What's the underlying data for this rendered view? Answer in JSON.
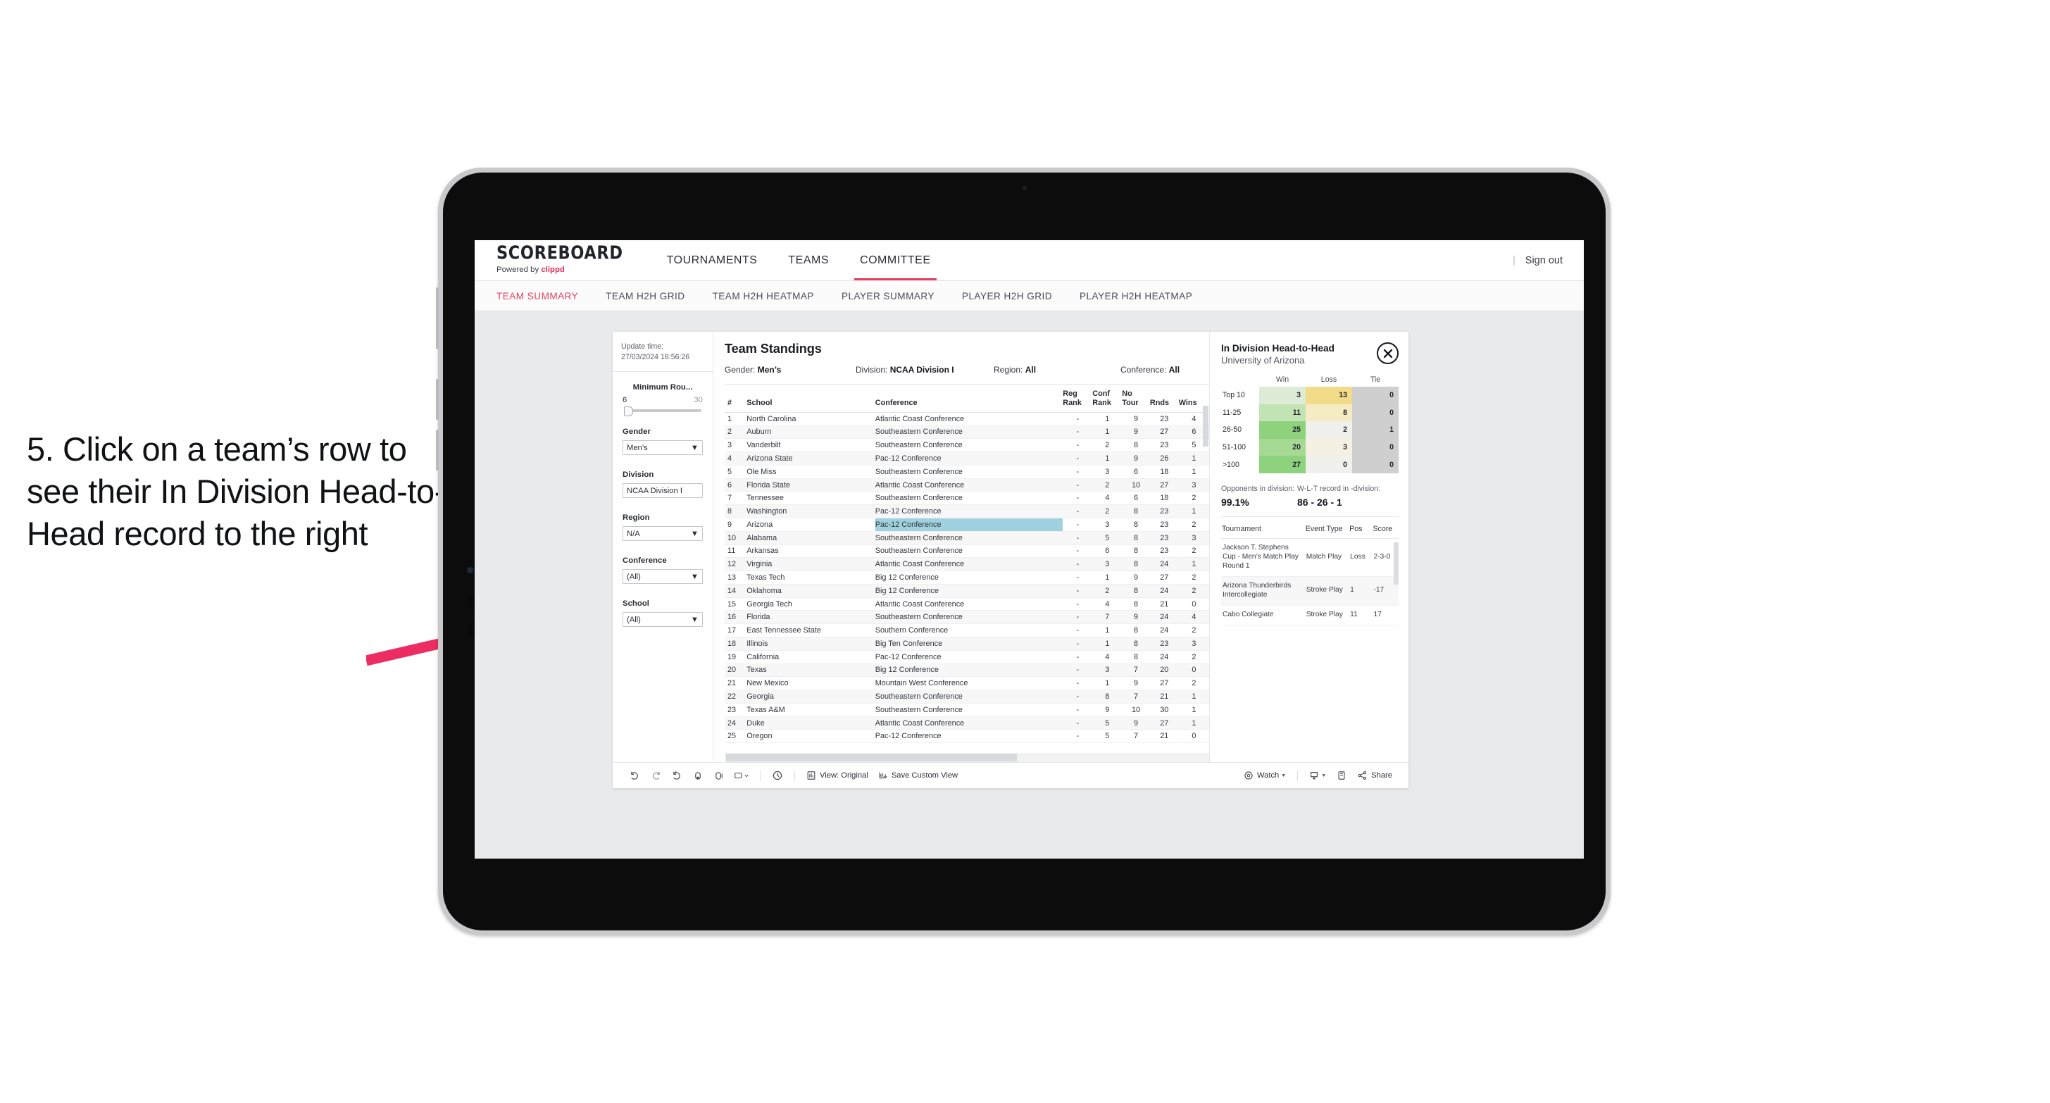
{
  "callout": {
    "text": "5. Click on a team’s row to see their In Division Head-to-Head record to the right"
  },
  "colors": {
    "accent_pink": "#e8415f",
    "arrow_pink": "#ec2d62",
    "highlight_cyan": "#9fd2de",
    "bezel_silver": "#c9c9cb"
  },
  "topnav": {
    "logo_word": "SCOREBOARD",
    "logo_powered": "Powered by ",
    "logo_brand": "clippd",
    "items": [
      {
        "label": "TOURNAMENTS",
        "active": false
      },
      {
        "label": "TEAMS",
        "active": false
      },
      {
        "label": "COMMITTEE",
        "active": true
      }
    ],
    "divider": "|",
    "signout": "Sign out"
  },
  "subnav": {
    "items": [
      {
        "label": "TEAM SUMMARY",
        "active": true
      },
      {
        "label": "TEAM H2H GRID",
        "active": false
      },
      {
        "label": "TEAM H2H HEATMAP",
        "active": false
      },
      {
        "label": "PLAYER SUMMARY",
        "active": false
      },
      {
        "label": "PLAYER H2H GRID",
        "active": false
      },
      {
        "label": "PLAYER H2H HEATMAP",
        "active": false
      }
    ]
  },
  "rail": {
    "update_label": "Update time:",
    "update_value": "27/03/2024 16:56:26",
    "slider": {
      "title": "Minimum Rou...",
      "min": "6",
      "max": "30"
    },
    "filters": [
      {
        "title": "Gender",
        "value": "Men’s"
      },
      {
        "title": "Division",
        "value": "NCAA Division I"
      },
      {
        "title": "Region",
        "value": "N/A"
      },
      {
        "title": "Conference",
        "value": "(All)"
      },
      {
        "title": "School",
        "value": "(All)"
      }
    ]
  },
  "standings": {
    "title": "Team Standings",
    "meta": [
      {
        "label": "Gender: ",
        "value": "Men’s"
      },
      {
        "label": "Division: ",
        "value": "NCAA Division I"
      },
      {
        "label": "Region: ",
        "value": "All"
      },
      {
        "label": "Conference: ",
        "value": "All"
      }
    ],
    "columns": [
      "#",
      "School",
      "Conference",
      "Reg Rank",
      "Conf Rank",
      "No Tour",
      "Rnds",
      "Wins"
    ],
    "rows": [
      {
        "n": "1",
        "school": "North Carolina",
        "conf": "Atlantic Coast Conference",
        "reg": "-",
        "cr": "1",
        "nt": "9",
        "rnds": "23",
        "wins": "4"
      },
      {
        "n": "2",
        "school": "Auburn",
        "conf": "Southeastern Conference",
        "reg": "-",
        "cr": "1",
        "nt": "9",
        "rnds": "27",
        "wins": "6"
      },
      {
        "n": "3",
        "school": "Vanderbilt",
        "conf": "Southeastern Conference",
        "reg": "-",
        "cr": "2",
        "nt": "8",
        "rnds": "23",
        "wins": "5"
      },
      {
        "n": "4",
        "school": "Arizona State",
        "conf": "Pac-12 Conference",
        "reg": "-",
        "cr": "1",
        "nt": "9",
        "rnds": "26",
        "wins": "1"
      },
      {
        "n": "5",
        "school": "Ole Miss",
        "conf": "Southeastern Conference",
        "reg": "-",
        "cr": "3",
        "nt": "6",
        "rnds": "18",
        "wins": "1"
      },
      {
        "n": "6",
        "school": "Florida State",
        "conf": "Atlantic Coast Conference",
        "reg": "-",
        "cr": "2",
        "nt": "10",
        "rnds": "27",
        "wins": "3"
      },
      {
        "n": "7",
        "school": "Tennessee",
        "conf": "Southeastern Conference",
        "reg": "-",
        "cr": "4",
        "nt": "6",
        "rnds": "18",
        "wins": "2"
      },
      {
        "n": "8",
        "school": "Washington",
        "conf": "Pac-12 Conference",
        "reg": "-",
        "cr": "2",
        "nt": "8",
        "rnds": "23",
        "wins": "1"
      },
      {
        "n": "9",
        "school": "Arizona",
        "conf": "Pac-12 Conference",
        "reg": "-",
        "cr": "3",
        "nt": "8",
        "rnds": "23",
        "wins": "2",
        "selected": true
      },
      {
        "n": "10",
        "school": "Alabama",
        "conf": "Southeastern Conference",
        "reg": "-",
        "cr": "5",
        "nt": "8",
        "rnds": "23",
        "wins": "3"
      },
      {
        "n": "11",
        "school": "Arkansas",
        "conf": "Southeastern Conference",
        "reg": "-",
        "cr": "6",
        "nt": "8",
        "rnds": "23",
        "wins": "2"
      },
      {
        "n": "12",
        "school": "Virginia",
        "conf": "Atlantic Coast Conference",
        "reg": "-",
        "cr": "3",
        "nt": "8",
        "rnds": "24",
        "wins": "1"
      },
      {
        "n": "13",
        "school": "Texas Tech",
        "conf": "Big 12 Conference",
        "reg": "-",
        "cr": "1",
        "nt": "9",
        "rnds": "27",
        "wins": "2"
      },
      {
        "n": "14",
        "school": "Oklahoma",
        "conf": "Big 12 Conference",
        "reg": "-",
        "cr": "2",
        "nt": "8",
        "rnds": "24",
        "wins": "2"
      },
      {
        "n": "15",
        "school": "Georgia Tech",
        "conf": "Atlantic Coast Conference",
        "reg": "-",
        "cr": "4",
        "nt": "8",
        "rnds": "21",
        "wins": "0"
      },
      {
        "n": "16",
        "school": "Florida",
        "conf": "Southeastern Conference",
        "reg": "-",
        "cr": "7",
        "nt": "9",
        "rnds": "24",
        "wins": "4"
      },
      {
        "n": "17",
        "school": "East Tennessee State",
        "conf": "Southern Conference",
        "reg": "-",
        "cr": "1",
        "nt": "8",
        "rnds": "24",
        "wins": "2"
      },
      {
        "n": "18",
        "school": "Illinois",
        "conf": "Big Ten Conference",
        "reg": "-",
        "cr": "1",
        "nt": "8",
        "rnds": "23",
        "wins": "3"
      },
      {
        "n": "19",
        "school": "California",
        "conf": "Pac-12 Conference",
        "reg": "-",
        "cr": "4",
        "nt": "8",
        "rnds": "24",
        "wins": "2"
      },
      {
        "n": "20",
        "school": "Texas",
        "conf": "Big 12 Conference",
        "reg": "-",
        "cr": "3",
        "nt": "7",
        "rnds": "20",
        "wins": "0"
      },
      {
        "n": "21",
        "school": "New Mexico",
        "conf": "Mountain West Conference",
        "reg": "-",
        "cr": "1",
        "nt": "9",
        "rnds": "27",
        "wins": "2"
      },
      {
        "n": "22",
        "school": "Georgia",
        "conf": "Southeastern Conference",
        "reg": "-",
        "cr": "8",
        "nt": "7",
        "rnds": "21",
        "wins": "1"
      },
      {
        "n": "23",
        "school": "Texas A&M",
        "conf": "Southeastern Conference",
        "reg": "-",
        "cr": "9",
        "nt": "10",
        "rnds": "30",
        "wins": "1"
      },
      {
        "n": "24",
        "school": "Duke",
        "conf": "Atlantic Coast Conference",
        "reg": "-",
        "cr": "5",
        "nt": "9",
        "rnds": "27",
        "wins": "1"
      },
      {
        "n": "25",
        "school": "Oregon",
        "conf": "Pac-12 Conference",
        "reg": "-",
        "cr": "5",
        "nt": "7",
        "rnds": "21",
        "wins": "0"
      }
    ]
  },
  "detail": {
    "title": "In Division Head-to-Head",
    "subtitle": "University of Arizona",
    "close_icon": "close-icon",
    "chart_data": {
      "type": "heatmap",
      "title": "In Division Head-to-Head",
      "subtitle": "University of Arizona",
      "columns": [
        "Win",
        "Loss",
        "Tie"
      ],
      "rows": [
        "Top 10",
        "11-25",
        "26-50",
        "51-100",
        ">100"
      ],
      "values": [
        [
          3,
          13,
          0
        ],
        [
          11,
          8,
          0
        ],
        [
          25,
          2,
          1
        ],
        [
          20,
          3,
          0
        ],
        [
          27,
          0,
          0
        ]
      ],
      "cell_colors": [
        [
          "#dcecd7",
          "#f2dc8a",
          "#cfcfcf"
        ],
        [
          "#c2e3b4",
          "#f6ecc3",
          "#cfcfcf"
        ],
        [
          "#8ed27e",
          "#f0f0ec",
          "#cfcfcf"
        ],
        [
          "#a6da94",
          "#f5f1e2",
          "#cfcfcf"
        ],
        [
          "#8ed27e",
          "#f0f0ec",
          "#cfcfcf"
        ]
      ],
      "legend": "",
      "grid": false
    },
    "stats": [
      {
        "label": "Opponents in division:",
        "value": "99.1%"
      },
      {
        "label": "W-L-T record in -division:",
        "value": "86 - 26 - 1"
      }
    ],
    "tournaments": {
      "columns": [
        "Tournament",
        "Event Type",
        "Pos",
        "Score"
      ],
      "rows": [
        {
          "name": "Jackson T. Stephens Cup - Men’s Match Play Round 1",
          "type": "Match Play",
          "pos": "Loss",
          "score": "2-3-0"
        },
        {
          "name": "Arizona Thunderbirds Intercollegiate",
          "type": "Stroke Play",
          "pos": "1",
          "score": "-17"
        },
        {
          "name": "Cabo Collegiate",
          "type": "Stroke Play",
          "pos": "11",
          "score": "17"
        }
      ]
    }
  },
  "toolbar": {
    "icons": [
      "undo-icon",
      "redo-icon",
      "revert-icon",
      "refresh-icon",
      "pause-icon",
      "rectangle-select-icon",
      "clock-icon"
    ],
    "view_label": "View: Original",
    "save_label": "Save Custom View",
    "watch_label": "Watch",
    "share_label": "Share",
    "download_icon": "download-icon",
    "fullscreen_icon": "fullscreen-icon",
    "share_icon": "share-icon"
  }
}
